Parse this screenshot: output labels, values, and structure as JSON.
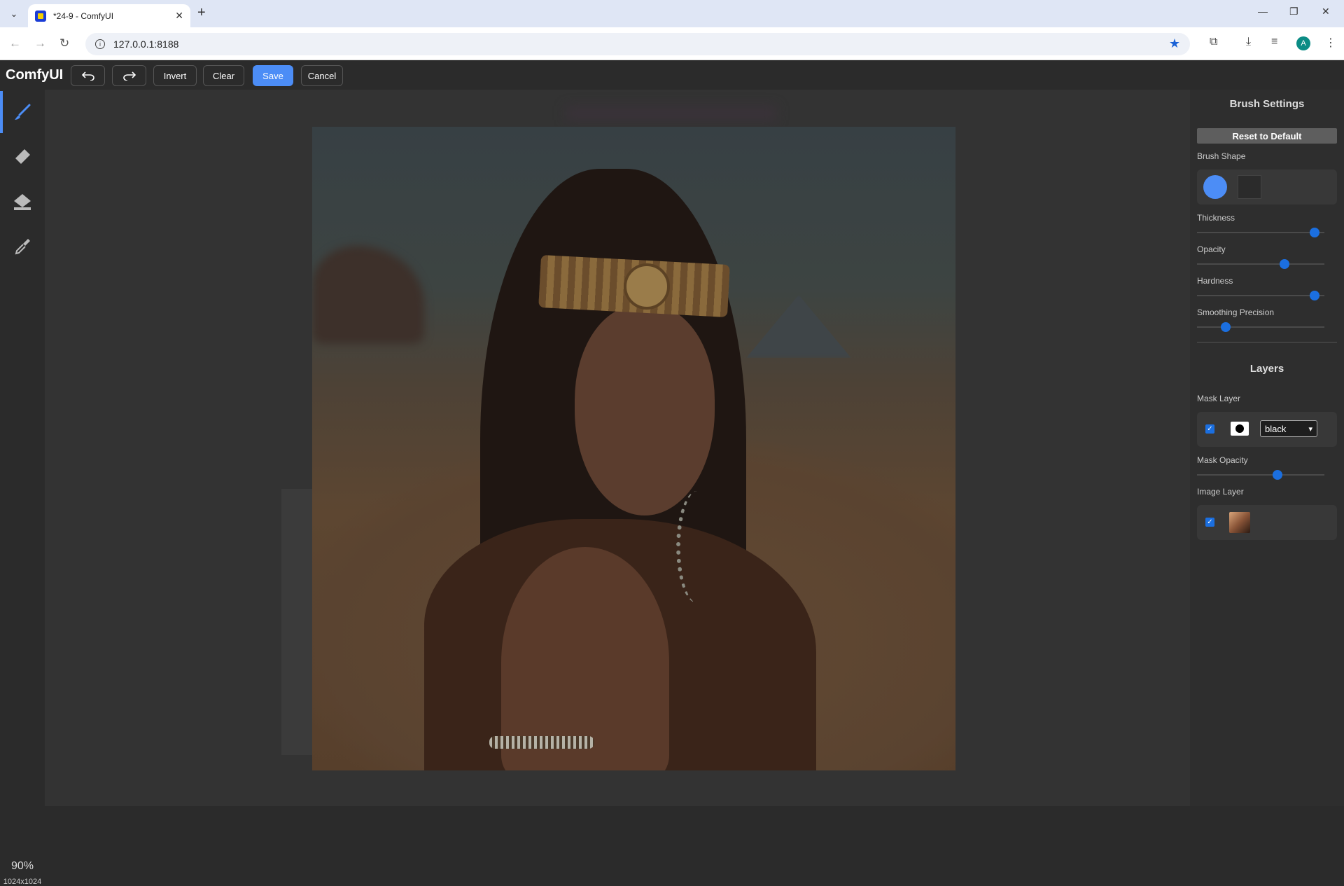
{
  "browser": {
    "tab_title": "*24-9 - ComfyUI",
    "tab_dropdown_icon": "chevron-down-icon",
    "new_tab_label": "+",
    "url": "127.0.0.1:8188",
    "profile_initial": "A"
  },
  "app": {
    "brand": "ComfyUI",
    "toolbar": {
      "undo_icon": "undo-icon",
      "redo_icon": "redo-icon",
      "invert_label": "Invert",
      "clear_label": "Clear",
      "save_label": "Save",
      "cancel_label": "Cancel"
    },
    "tools": [
      {
        "name": "brush",
        "icon": "brush-icon",
        "active": true
      },
      {
        "name": "eraser",
        "icon": "eraser-icon",
        "active": false
      },
      {
        "name": "paint-bucket",
        "icon": "paint-bucket-icon",
        "active": false
      },
      {
        "name": "color-picker",
        "icon": "eyedropper-icon",
        "active": false
      }
    ],
    "zoom": "90%",
    "image_size": "1024x1024"
  },
  "brush_settings": {
    "title": "Brush Settings",
    "reset_label": "Reset to Default",
    "shape_label": "Brush Shape",
    "selected_shape": "circle",
    "sliders": [
      {
        "label": "Thickness",
        "value": 0.96
      },
      {
        "label": "Opacity",
        "value": 0.7
      },
      {
        "label": "Hardness",
        "value": 0.96
      },
      {
        "label": "Smoothing Precision",
        "value": 0.2
      }
    ]
  },
  "layers": {
    "title": "Layers",
    "mask_layer_label": "Mask Layer",
    "mask_visible": true,
    "mask_color": "black",
    "mask_opacity_label": "Mask Opacity",
    "mask_opacity_value": 0.64,
    "image_layer_label": "Image Layer",
    "image_visible": true
  },
  "colors": {
    "accent": "#4c8df6",
    "slider_knob": "#1b6fe0",
    "background": "#2b2b2b"
  }
}
